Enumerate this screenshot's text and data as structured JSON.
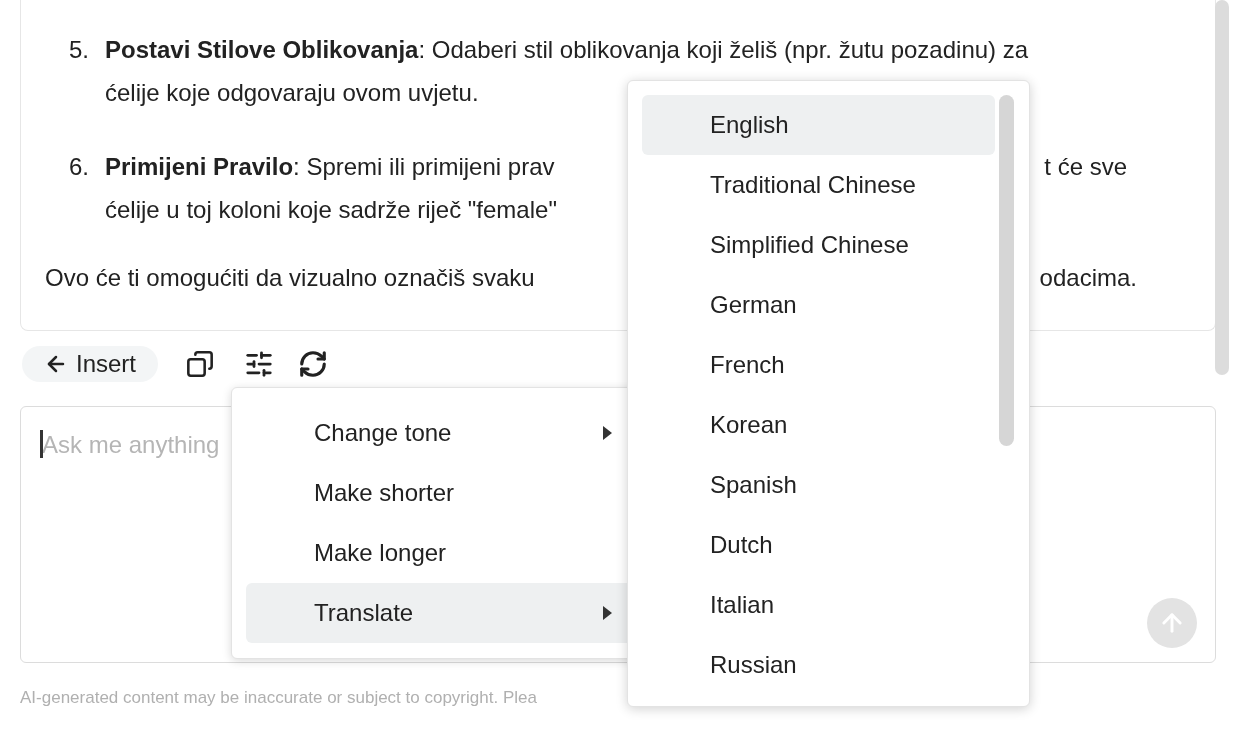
{
  "answer": {
    "steps": [
      {
        "number": "5.",
        "lines": [
          [
            "**Postavi Stilove Oblikovanja**: Odaberi stil oblikovanja koji želiš (npr. žutu pozadinu) za"
          ],
          [
            "ćelije koje odgovaraju ovom uvjetu."
          ]
        ]
      },
      {
        "number": "6.",
        "lines": [
          [
            "**Primijeni Pravilo**: Spremi ili primijeni prav",
            "t će sve"
          ],
          [
            "ćelije u toj koloni koje sadrže riječ \"female\""
          ]
        ]
      }
    ],
    "summary": [
      "Ovo će ti omogućiti da vizualno označiš svaku",
      "odacima."
    ]
  },
  "toolbar": {
    "insert_label": "Insert"
  },
  "prompt": {
    "placeholder": "Ask me anything"
  },
  "disclaimer": "AI-generated content may be inaccurate or subject to copyright. Plea",
  "action_menu": [
    {
      "label": "Change tone",
      "submenu": true,
      "selected": false
    },
    {
      "label": "Make shorter",
      "submenu": false,
      "selected": false
    },
    {
      "label": "Make longer",
      "submenu": false,
      "selected": false
    },
    {
      "label": "Translate",
      "submenu": true,
      "selected": true
    }
  ],
  "language_menu": [
    {
      "label": "English",
      "selected": true
    },
    {
      "label": "Traditional Chinese",
      "selected": false
    },
    {
      "label": "Simplified Chinese",
      "selected": false
    },
    {
      "label": "German",
      "selected": false
    },
    {
      "label": "French",
      "selected": false
    },
    {
      "label": "Korean",
      "selected": false
    },
    {
      "label": "Spanish",
      "selected": false
    },
    {
      "label": "Dutch",
      "selected": false
    },
    {
      "label": "Italian",
      "selected": false
    },
    {
      "label": "Russian",
      "selected": false
    }
  ]
}
